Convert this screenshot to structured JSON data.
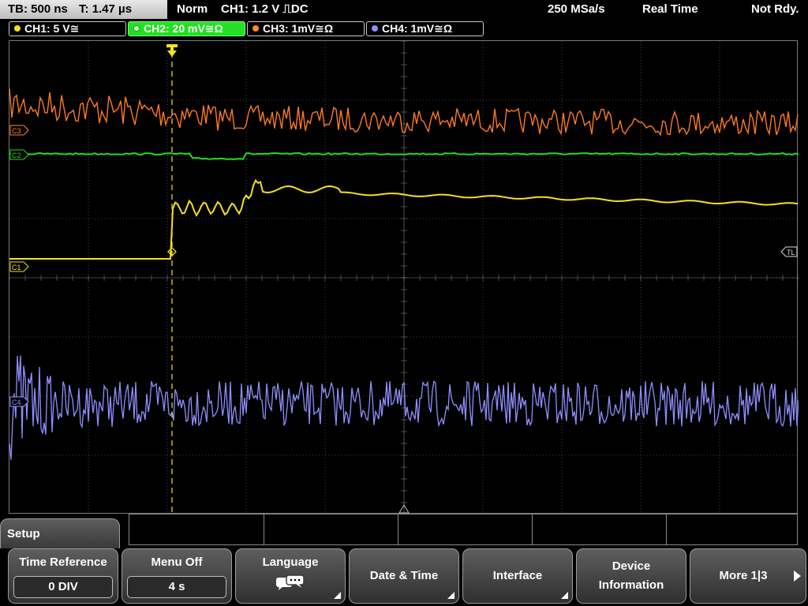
{
  "status": {
    "timebase": "TB: 500 ns",
    "trigger_time": "T: 1.47 µs",
    "mode": "Norm",
    "trigger_source": "CH1: 1.2 V",
    "trigger_edge_symbol": "⎍",
    "trigger_coupling": "DC",
    "sample_rate": "250 MSa/s",
    "acquisition": "Real Time",
    "state": "Not Rdy."
  },
  "channels": [
    {
      "label": "CH1: 5 V≅",
      "color": "#f4e21b",
      "active": false
    },
    {
      "label": "CH2: 20 mV≅Ω",
      "color": "#1ee01e",
      "active": true
    },
    {
      "label": "CH3: 1mV≅Ω",
      "color": "#ff8a2a",
      "active": false
    },
    {
      "label": "CH4: 1mV≅Ω",
      "color": "#8f8fff",
      "active": false
    }
  ],
  "markers": {
    "c3": "C3",
    "c2": "C2",
    "c1": "C1",
    "c4": "C4",
    "trigger_level": "TL"
  },
  "menu": {
    "title": "Setup",
    "softkeys": [
      {
        "label": "Time Reference",
        "value": "0 DIV"
      },
      {
        "label": "Menu Off",
        "value": "4 s"
      },
      {
        "label": "Language",
        "icon": "speech-bubble-icon"
      },
      {
        "label": "Date & Time"
      },
      {
        "label": "Interface"
      },
      {
        "label": "Device Information"
      },
      {
        "label": "More 1|3"
      }
    ]
  },
  "colors": {
    "ch1": "#f4e21b",
    "ch2": "#1ee01e",
    "ch3": "#ff7a22",
    "ch4": "#8f8fff",
    "grid": "#7a7a7a"
  }
}
